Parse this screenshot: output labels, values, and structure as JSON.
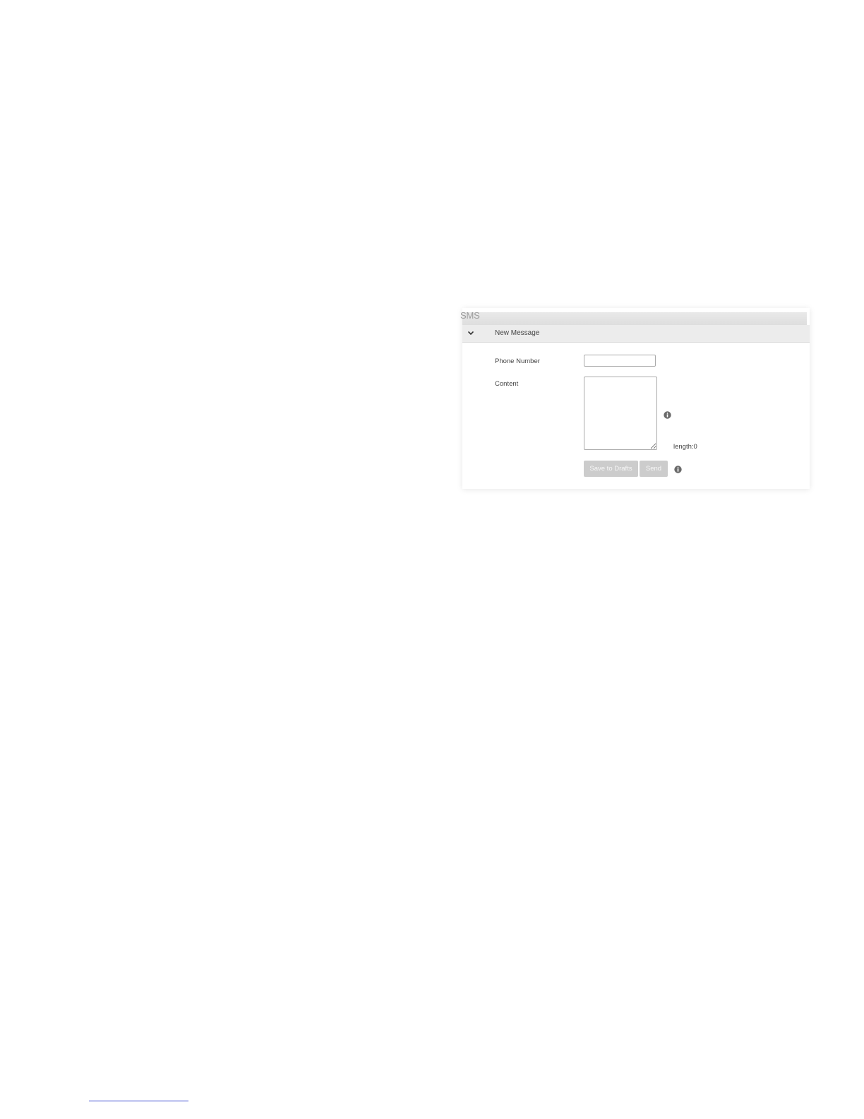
{
  "sms": {
    "title": "SMS",
    "section_header": "New Message",
    "labels": {
      "phone": "Phone Number",
      "content": "Content"
    },
    "phone_value": "",
    "content_value": "",
    "length_text": "length:0",
    "buttons": {
      "save_drafts": "Save to Drafts",
      "send": "Send"
    }
  },
  "colors": {
    "button_disabled": "#cccccc",
    "header_bg": "#ececec",
    "footnote_rule": "#3b4bd0"
  },
  "icons": [
    "chevron-down-icon",
    "info-icon"
  ]
}
